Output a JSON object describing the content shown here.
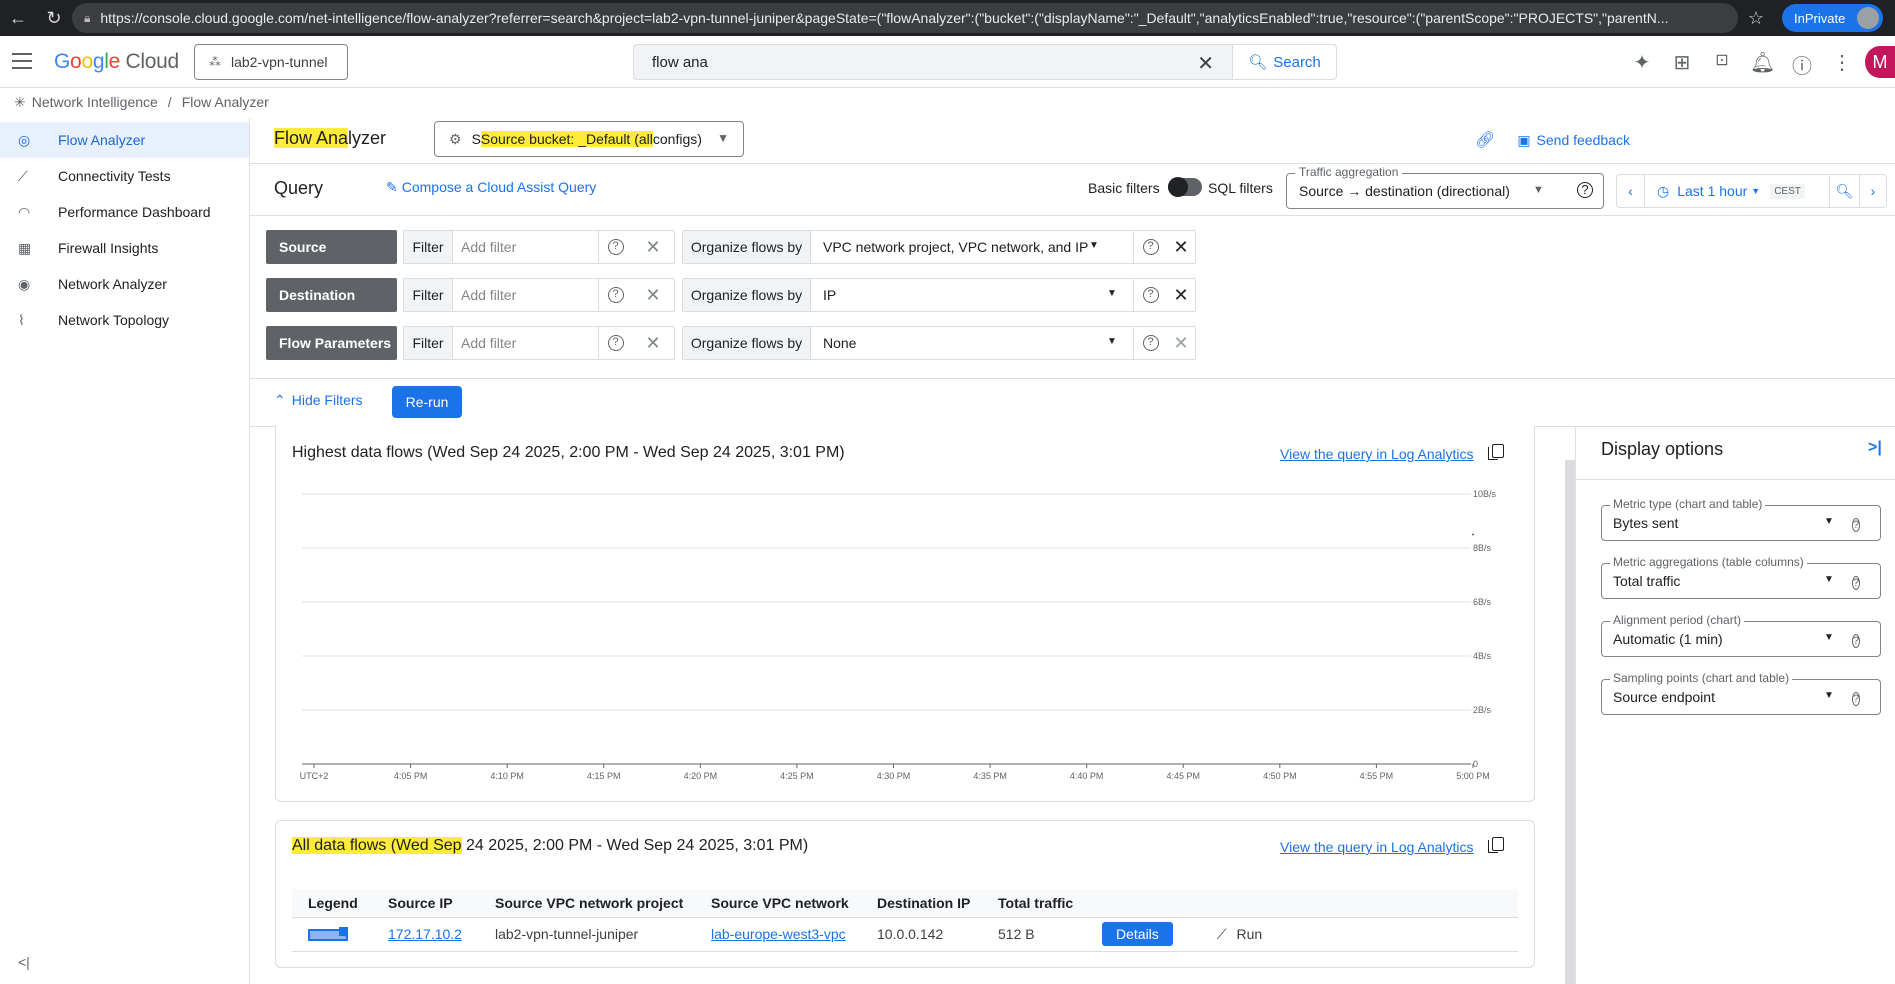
{
  "browser": {
    "url": "https://console.cloud.google.com/net-intelligence/flow-analyzer?referrer=search&project=lab2-vpn-tunnel-juniper&pageState=(\"flowAnalyzer\":(\"bucket\":(\"displayName\":\"_Default\",\"analyticsEnabled\":true,\"resource\":(\"parentScope\":\"PROJECTS\",\"parentN...",
    "inprivate_label": "InPrivate"
  },
  "header": {
    "logo_parts": [
      "G",
      "o",
      "o",
      "g",
      "l",
      "e"
    ],
    "logo_suffix": "Cloud",
    "project": "lab2-vpn-tunnel",
    "search_value": "flow ana",
    "search_button": "Search",
    "avatar_letter": "M"
  },
  "breadcrumb": {
    "root": "Network Intelligence",
    "separator": "/",
    "current": "Flow Analyzer"
  },
  "sidebar": {
    "items": [
      {
        "label": "Flow Analyzer",
        "icon": "flow-analyzer-icon",
        "active": true
      },
      {
        "label": "Connectivity Tests",
        "icon": "connectivity-tests-icon"
      },
      {
        "label": "Performance Dashboard",
        "icon": "performance-dashboard-icon"
      },
      {
        "label": "Firewall Insights",
        "icon": "firewall-insights-icon"
      },
      {
        "label": "Network Analyzer",
        "icon": "network-analyzer-icon"
      },
      {
        "label": "Network Topology",
        "icon": "network-topology-icon"
      }
    ]
  },
  "page": {
    "title_highlight": "Flow Ana",
    "title_rest": "lyzer",
    "bucket_highlight": "Source bucket: _Default (all",
    "bucket_rest": " configs)",
    "bucket_prefix": "S",
    "send_feedback": "Send feedback"
  },
  "query": {
    "title": "Query",
    "compose": "Compose a Cloud Assist Query",
    "basic_filters": "Basic filters",
    "sql_filters": "SQL filters",
    "traffic_label": "Traffic aggregation",
    "traffic_value": "Source → destination (directional)",
    "time_range": "Last 1 hour",
    "timezone": "CEST"
  },
  "filters": {
    "filter_label": "Filter",
    "placeholder": "Add filter",
    "organize_label": "Organize flows by",
    "rows": [
      {
        "name": "Source",
        "organize": "VPC network project, VPC network, and IP"
      },
      {
        "name": "Destination",
        "organize": "IP"
      },
      {
        "name": "Flow Parameters",
        "organize": "None"
      }
    ],
    "hide_filters": "Hide Filters",
    "rerun": "Re-run"
  },
  "chart_card": {
    "title": "Highest data flows (Wed Sep 24 2025, 2:00 PM - Wed Sep 24 2025, 3:01 PM)",
    "link": "View the query in Log Analytics"
  },
  "chart_data": {
    "type": "line",
    "x": [
      "UTC+2",
      "4:05 PM",
      "4:10 PM",
      "4:15 PM",
      "4:20 PM",
      "4:25 PM",
      "4:30 PM",
      "4:35 PM",
      "4:40 PM",
      "4:45 PM",
      "4:50 PM",
      "4:55 PM",
      "5:00 PM"
    ],
    "y_ticks": [
      "10B/s",
      "8B/s",
      "6B/s",
      "4B/s",
      "2B/s",
      "0"
    ],
    "ylim": [
      0,
      10
    ],
    "series": [
      {
        "values": [
          null,
          null,
          null,
          null,
          null,
          null,
          null,
          null,
          null,
          null,
          null,
          null,
          8.5
        ]
      }
    ],
    "grid": true
  },
  "table_card": {
    "title_highlight": "All data flows (Wed Sep",
    "title_rest": " 24 2025, 2:00 PM - Wed Sep 24 2025, 3:01 PM)",
    "link": "View the query in Log Analytics",
    "columns": [
      "Legend",
      "Source IP",
      "Source VPC network project",
      "Source VPC network",
      "Destination IP",
      "Total traffic"
    ],
    "rows": [
      {
        "source_ip": "172.17.10.2",
        "project": "lab2-vpn-tunnel-juniper",
        "network": "lab-europe-west3-vpc",
        "dest_ip": "10.0.0.142",
        "traffic": "512 B",
        "details": "Details",
        "run": "Run"
      }
    ]
  },
  "display_options": {
    "title": "Display options",
    "fields": [
      {
        "label": "Metric type (chart and table)",
        "value": "Bytes sent"
      },
      {
        "label": "Metric aggregations (table columns)",
        "value": "Total traffic"
      },
      {
        "label": "Alignment period (chart)",
        "value": "Automatic (1 min)"
      },
      {
        "label": "Sampling points (chart and table)",
        "value": "Source endpoint"
      }
    ]
  },
  "colors": {
    "accent": "#1a73e8",
    "highlight": "#ffeb3b",
    "filter_label_bg": "#5f6368"
  }
}
